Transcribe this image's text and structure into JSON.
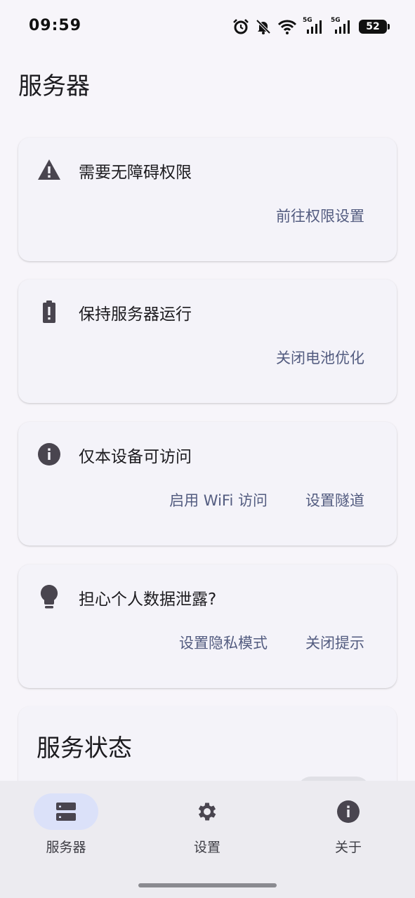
{
  "status_bar": {
    "time": "09:59",
    "network_5g_1": "5G",
    "network_5g_2": "5G",
    "battery": "52"
  },
  "page": {
    "title": "服务器"
  },
  "cards": [
    {
      "title": "需要无障碍权限",
      "icon": "warning-icon",
      "actions": [
        "前往权限设置"
      ]
    },
    {
      "title": "保持服务器运行",
      "icon": "battery-alert-icon",
      "actions": [
        "关闭电池优化"
      ]
    },
    {
      "title": "仅本设备可访问",
      "icon": "info-icon",
      "actions": [
        "启用 WiFi 访问",
        "设置隧道"
      ]
    },
    {
      "title": "担心个人数据泄露?",
      "icon": "lightbulb-icon",
      "actions": [
        "设置隐私模式",
        "关闭提示"
      ]
    }
  ],
  "service_status": {
    "title": "服务状态"
  },
  "nav": {
    "items": [
      {
        "label": "服务器",
        "icon": "server-icon",
        "active": true
      },
      {
        "label": "设置",
        "icon": "gear-icon",
        "active": false
      },
      {
        "label": "关于",
        "icon": "info-icon",
        "active": false
      }
    ]
  },
  "colors": {
    "background": "#f7f5fa",
    "card": "#f4f3f9",
    "action_text": "#535c80",
    "nav_active_pill": "#dbe1f9",
    "nav_background": "#ecebf0"
  }
}
